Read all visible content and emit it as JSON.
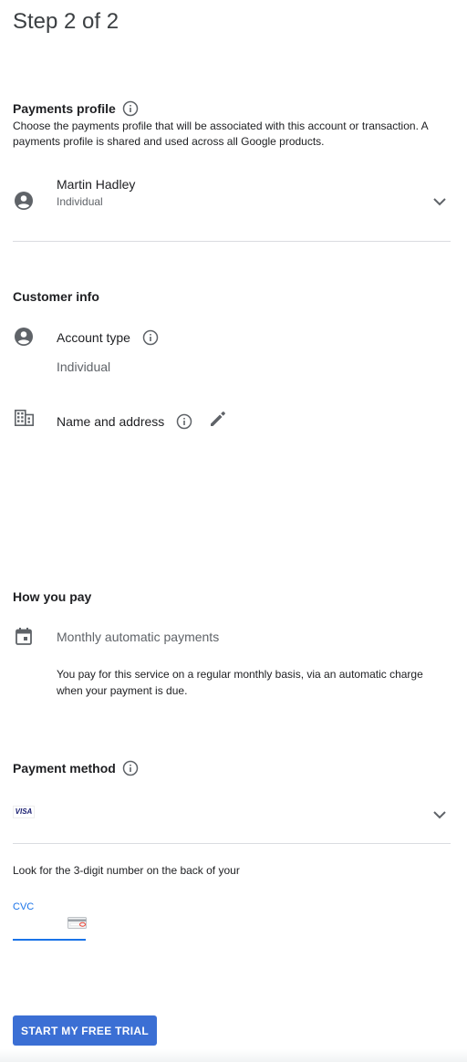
{
  "step": {
    "title": "Step 2 of 2"
  },
  "payments_profile": {
    "title": "Payments profile",
    "description": "Choose the payments profile that will be associated with this account or transaction. A payments profile is shared and used across all Google products.",
    "name": "Martin Hadley",
    "type": "Individual",
    "icons": {
      "person": "person-icon",
      "info": "info-icon",
      "dropdown": "chevron-down-icon"
    }
  },
  "customer_info": {
    "title": "Customer info",
    "account_type_label": "Account type",
    "account_type_value": "Individual",
    "name_address_label": "Name and address",
    "icons": {
      "person": "person-icon",
      "building": "building-icon",
      "info": "info-icon",
      "edit": "pencil-icon"
    }
  },
  "how_you_pay": {
    "title": "How you pay",
    "method": "Monthly automatic payments",
    "description": "You pay for this service on a regular monthly basis, via an automatic charge when your payment is due.",
    "icons": {
      "calendar": "calendar-icon"
    }
  },
  "payment_method": {
    "title": "Payment method",
    "card_brand": "VISA",
    "cvc_hint": "Look for the 3-digit number on the back of your",
    "cvc_label": "CVC",
    "cvc_value": "",
    "icons": {
      "info": "info-icon",
      "dropdown": "chevron-down-icon",
      "card": "card-back-icon"
    }
  },
  "actions": {
    "submit_label": "START MY FREE TRIAL"
  },
  "colors": {
    "accent": "#1a73e8",
    "button": "#3b6fd4",
    "divider": "#dadce0",
    "icon": "#5f6368"
  }
}
